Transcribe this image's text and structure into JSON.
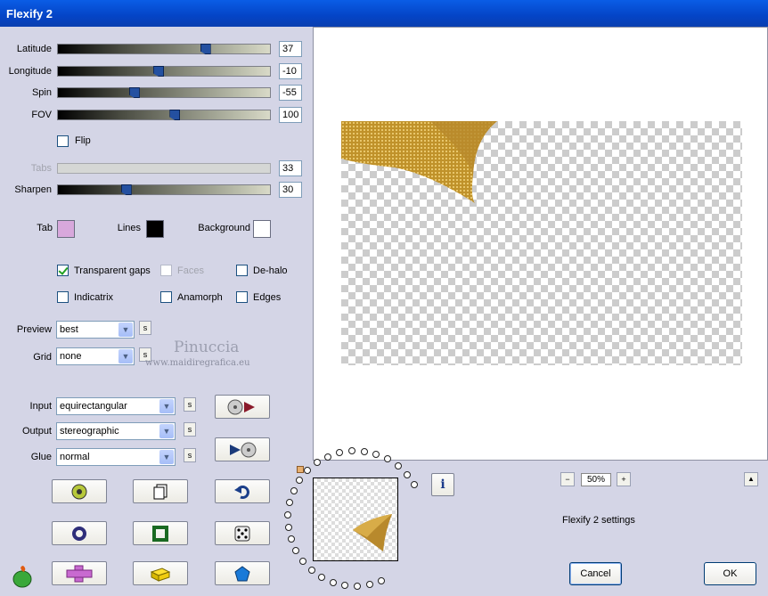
{
  "window": {
    "title": "Flexify 2"
  },
  "sliders": [
    {
      "label": "Latitude",
      "value": "37",
      "level": 0.7,
      "enabled": true
    },
    {
      "label": "Longitude",
      "value": "-10",
      "level": 0.47,
      "enabled": true
    },
    {
      "label": "Spin",
      "value": "-55",
      "level": 0.35,
      "enabled": true
    },
    {
      "label": "FOV",
      "value": "100",
      "level": 0.55,
      "enabled": true
    },
    {
      "label": "Tabs",
      "value": "33",
      "level": null,
      "enabled": false
    },
    {
      "label": "Sharpen",
      "value": "30",
      "level": 0.31,
      "enabled": true
    }
  ],
  "flip": {
    "label": "Flip",
    "checked": false
  },
  "colors": {
    "tab": {
      "label": "Tab",
      "color": "#d8a8dc"
    },
    "lines": {
      "label": "Lines",
      "color": "#000000"
    },
    "background": {
      "label": "Background",
      "color": "#ffffff"
    }
  },
  "options": {
    "transparent_gaps": {
      "label": "Transparent gaps",
      "checked": true
    },
    "faces": {
      "label": "Faces",
      "checked": false
    },
    "de_halo": {
      "label": "De-halo",
      "checked": false
    },
    "indicatrix": {
      "label": "Indicatrix",
      "checked": false
    },
    "anamorph": {
      "label": "Anamorph",
      "checked": false
    },
    "edges": {
      "label": "Edges",
      "checked": false
    }
  },
  "preview_select": {
    "label": "Preview",
    "value": "best"
  },
  "grid_select": {
    "label": "Grid",
    "value": "none"
  },
  "input_select": {
    "label": "Input",
    "value": "equirectangular"
  },
  "output_select": {
    "label": "Output",
    "value": "stereographic"
  },
  "glue_select": {
    "label": "Glue",
    "value": "normal"
  },
  "s_label": "s",
  "watermark": {
    "line1": "Pinuccia",
    "line2": "www.maidiregrafica.eu"
  },
  "zoom": {
    "minus": "−",
    "value": "50%",
    "plus": "+"
  },
  "settings_name": "Flexify 2 settings",
  "buttons": {
    "cancel": "Cancel",
    "ok": "OK",
    "info": "i",
    "collapse": "▲"
  },
  "icons": [
    "cd-forward-icon",
    "forward-cd-icon",
    "randomize-icon",
    "copy-icon",
    "undo-icon",
    "circle-icon",
    "square-icon",
    "dice-icon",
    "plus-shape-icon",
    "lego-brick-icon",
    "pentagon-icon",
    "flaming-pear-logo-icon"
  ]
}
